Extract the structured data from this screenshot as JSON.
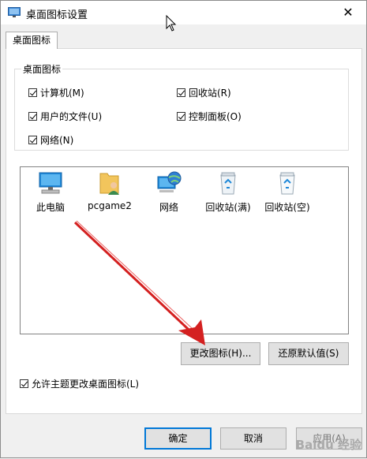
{
  "window": {
    "title": "桌面图标设置",
    "close_glyph": "✕"
  },
  "tab": {
    "label": "桌面图标"
  },
  "group": {
    "label": "桌面图标",
    "checkboxes": [
      {
        "label": "计算机(M)",
        "checked": true
      },
      {
        "label": "回收站(R)",
        "checked": true
      },
      {
        "label": "用户的文件(U)",
        "checked": true
      },
      {
        "label": "控制面板(O)",
        "checked": true
      },
      {
        "label": "网络(N)",
        "checked": true
      }
    ]
  },
  "icons": [
    {
      "label": "此电脑",
      "icon": "computer-icon"
    },
    {
      "label": "pcgame2",
      "icon": "user-folder-icon"
    },
    {
      "label": "网络",
      "icon": "network-icon"
    },
    {
      "label": "回收站(满)",
      "icon": "recycle-bin-full-icon"
    },
    {
      "label": "回收站(空)",
      "icon": "recycle-bin-empty-icon"
    }
  ],
  "buttons": {
    "change_icon": "更改图标(H)...",
    "restore_default": "还原默认值(S)",
    "ok": "确定",
    "cancel": "取消",
    "apply": "应用(A)"
  },
  "theme_checkbox": {
    "label": "允许主题更改桌面图标(L)",
    "checked": true
  },
  "watermark": "Baidu 经验",
  "colors": {
    "accent": "#0078d7",
    "arrow": "#d42020"
  }
}
